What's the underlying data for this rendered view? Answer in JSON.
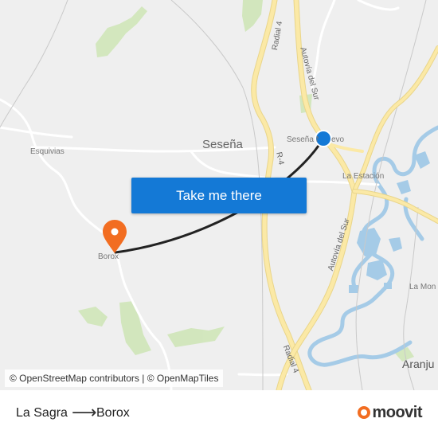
{
  "map": {
    "labels": {
      "town_sesena": "Seseña",
      "town_sesena_nuevo": "Seseña Nuevo",
      "esquivias": "Esquivias",
      "borox": "Borox",
      "la_estacion": "La Estación",
      "la_mon": "La Mon",
      "aranjuez": "Aranju",
      "radial4_top": "Radial 4",
      "radial4_bottom": "Radial 4",
      "r4": "R-4",
      "autovia_sur_top": "Autovía del Sur",
      "autovia_sur_bottom": "Autovía del Sur"
    },
    "cta_label": "Take me there",
    "attribution": "© OpenStreetMap contributors | © OpenMapTiles",
    "colors": {
      "background": "#efefef",
      "highway": "#fbe9a6",
      "highway_edge": "#e9d58a",
      "road": "#ffffff",
      "water": "#a5cbe7",
      "green": "#cfe6b8",
      "route": "#222222",
      "origin_dot": "#1479d6",
      "destination_pin": "#f26d21"
    }
  },
  "footer": {
    "origin": "La Sagra",
    "arrow": "⟶",
    "destination": "Borox",
    "brand": "moovit"
  }
}
